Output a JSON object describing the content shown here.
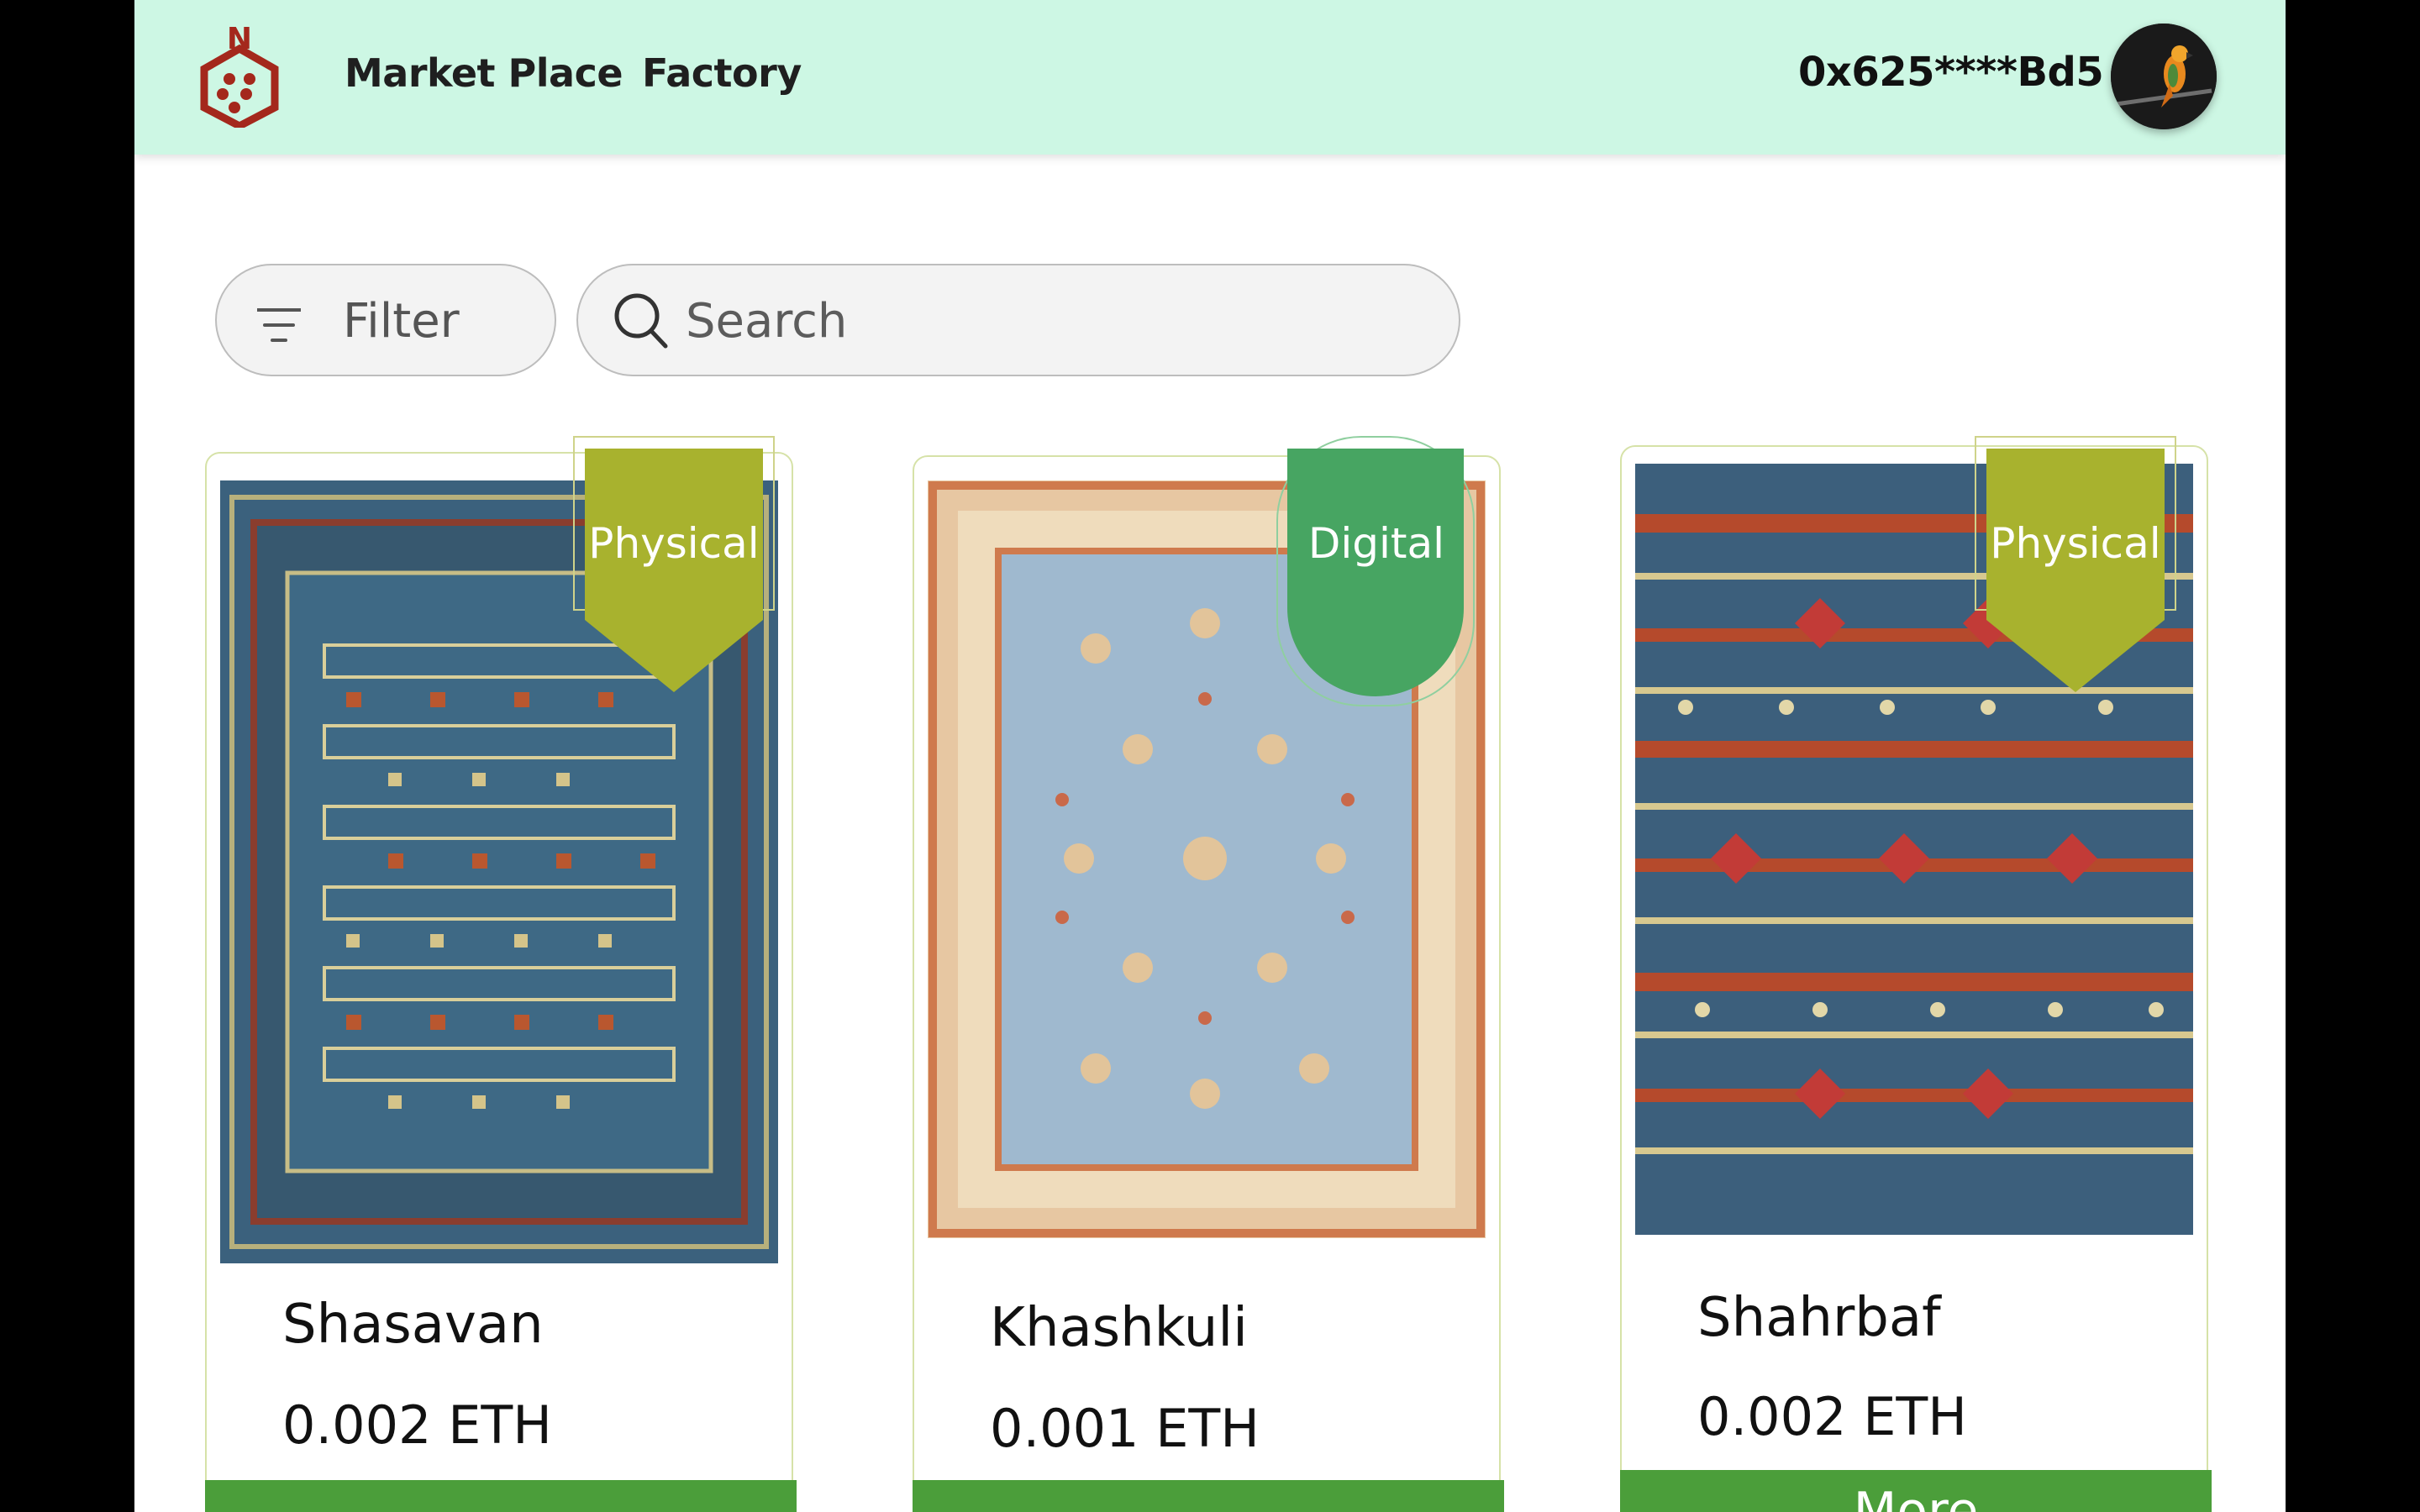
{
  "header": {
    "nav": [
      {
        "label": "Market Place"
      },
      {
        "label": "Factory"
      }
    ],
    "wallet": "0x625****Bd5",
    "logo_letter": "N"
  },
  "toolbar": {
    "filter_label": "Filter",
    "search_placeholder": "Search"
  },
  "products": [
    {
      "name": "Shasavan",
      "price": "0.002 ETH",
      "badge": "Physical",
      "badge_color": "#a8b22e"
    },
    {
      "name": "Khashkuli",
      "price": "0.001 ETH",
      "badge": "Digital",
      "badge_color": "#47a562"
    },
    {
      "name": "Shahrbaf",
      "price": "0.002 ETH",
      "badge": "Physical",
      "badge_color": "#a8b22e",
      "button_label": "More"
    }
  ],
  "colors": {
    "header_bg": "#cdf7e4",
    "accent_green": "#4b9e3a",
    "logo_red": "#a4281c"
  }
}
